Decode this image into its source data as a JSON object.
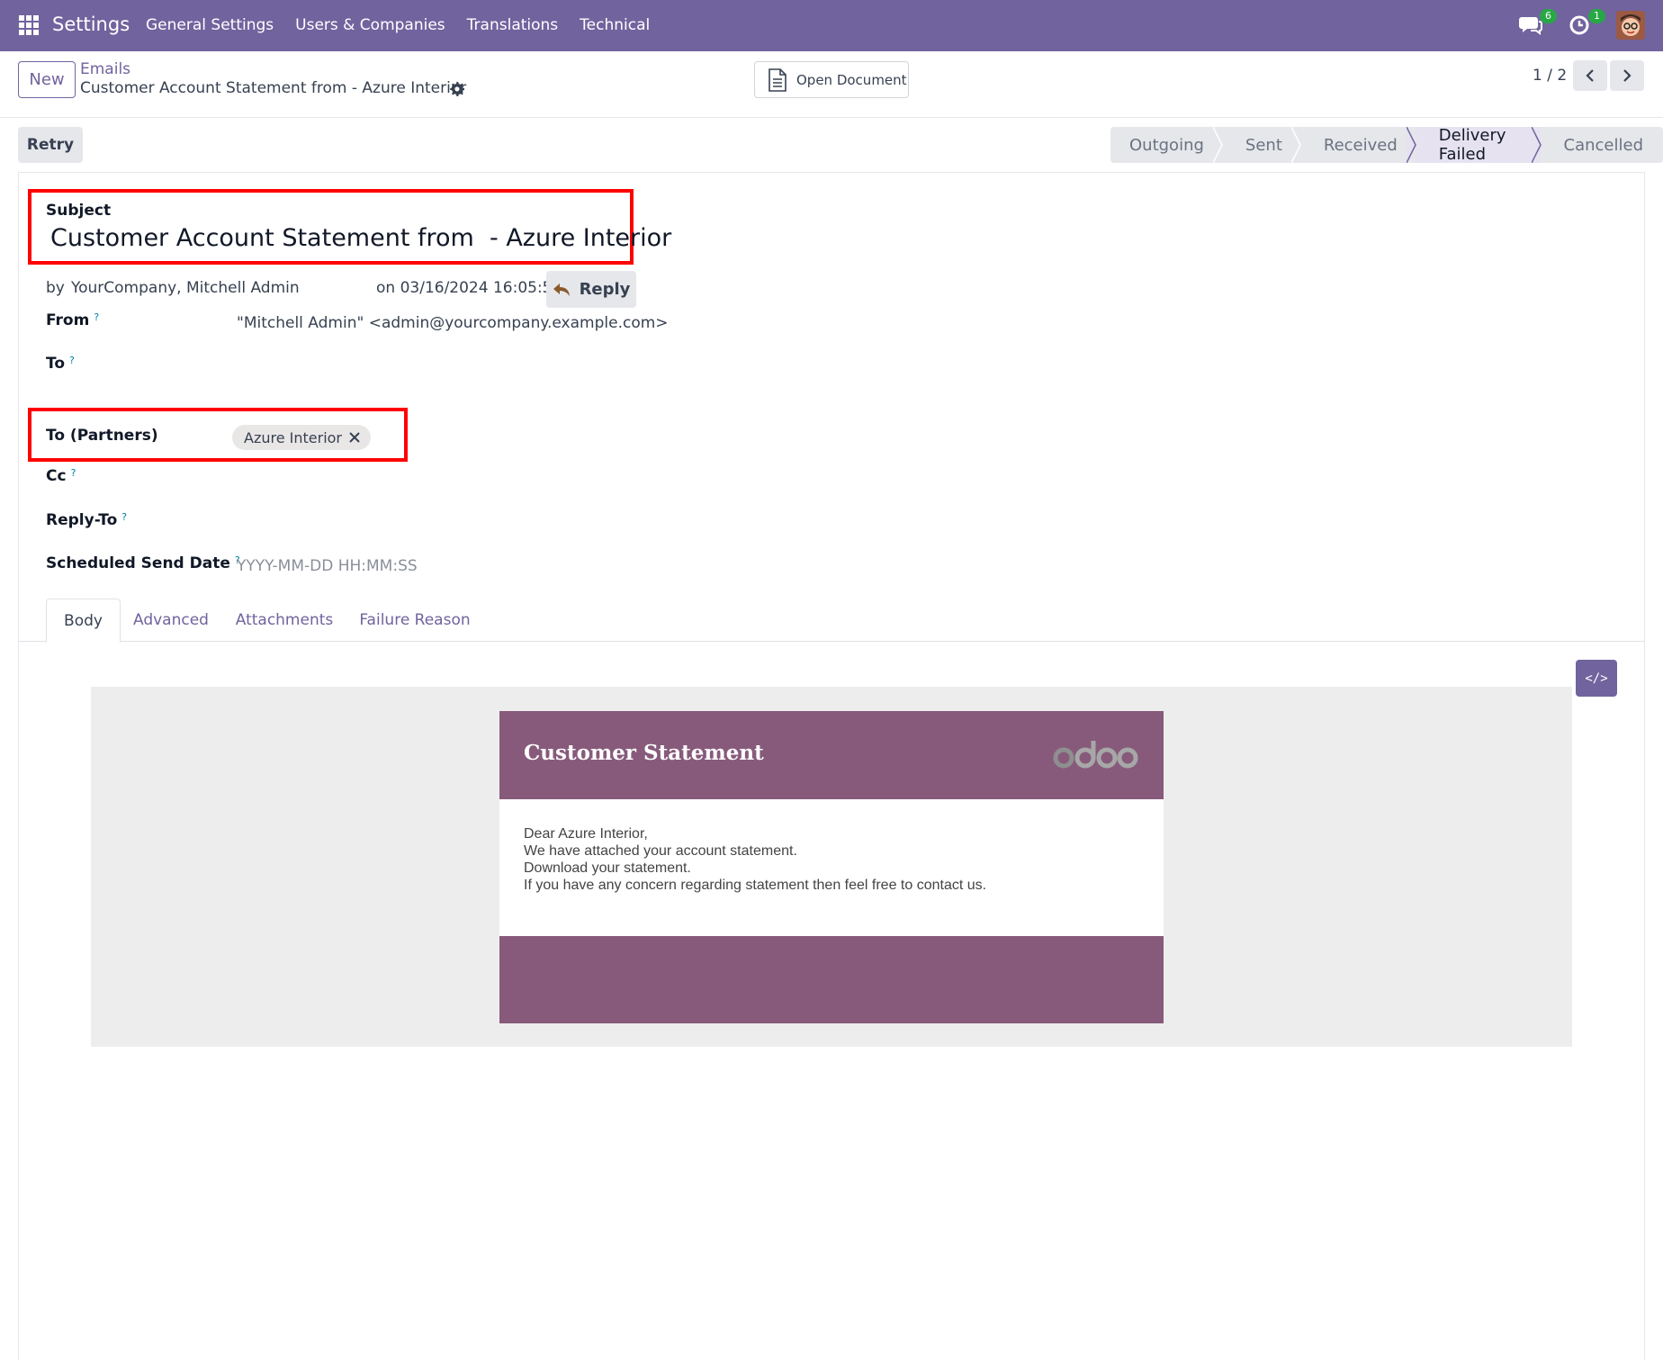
{
  "topbar": {
    "brand": "Settings",
    "menu": [
      "General Settings",
      "Users & Companies",
      "Translations",
      "Technical"
    ],
    "messages_count": "6",
    "activities_count": "1",
    "accent": "#71639e"
  },
  "control": {
    "new_label": "New",
    "breadcrumb_parent": "Emails",
    "breadcrumb_current": "Customer Account Statement from - Azure Interior",
    "open_document_label": "Open Document",
    "pager": "1 / 2"
  },
  "actions": {
    "retry_label": "Retry"
  },
  "statusbar": {
    "stages": [
      "Outgoing",
      "Sent",
      "Received",
      "Delivery Failed",
      "Cancelled"
    ],
    "active": "Delivery Failed"
  },
  "form": {
    "subject_label": "Subject",
    "subject_value": "Customer Account Statement from  - Azure Interior",
    "author_prefix": "by",
    "author": "YourCompany, Mitchell Admin",
    "date": "on 03/16/2024 16:05:51",
    "reply_label": "Reply",
    "from_label": "From",
    "from_value": "\"Mitchell Admin\" <admin@yourcompany.example.com>",
    "to_label": "To",
    "to_partners_label": "To (Partners)",
    "to_partners_tag": "Azure Interior",
    "cc_label": "Cc",
    "reply_to_label": "Reply-To",
    "scheduled_label": "Scheduled Send Date",
    "scheduled_placeholder": "YYYY-MM-DD HH:MM:SS",
    "help_mark": "?"
  },
  "tabs": [
    "Body",
    "Advanced",
    "Attachments",
    "Failure Reason"
  ],
  "email": {
    "title": "Customer Statement",
    "logo_text": "odoo",
    "lines": [
      "Dear Azure Interior,",
      "We have attached your account statement.",
      "Download your statement.",
      "If you have any concern regarding statement then feel free to contact us."
    ],
    "brand_color": "#875a7b"
  },
  "code_button_label": "</>"
}
